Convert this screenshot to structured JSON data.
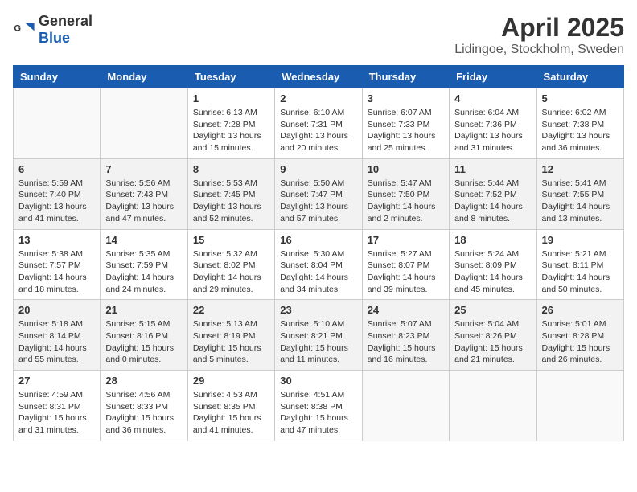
{
  "header": {
    "logo_general": "General",
    "logo_blue": "Blue",
    "month_year": "April 2025",
    "location": "Lidingoe, Stockholm, Sweden"
  },
  "days_of_week": [
    "Sunday",
    "Monday",
    "Tuesday",
    "Wednesday",
    "Thursday",
    "Friday",
    "Saturday"
  ],
  "weeks": [
    [
      {
        "day": "",
        "info": ""
      },
      {
        "day": "",
        "info": ""
      },
      {
        "day": "1",
        "info": "Sunrise: 6:13 AM\nSunset: 7:28 PM\nDaylight: 13 hours and 15 minutes."
      },
      {
        "day": "2",
        "info": "Sunrise: 6:10 AM\nSunset: 7:31 PM\nDaylight: 13 hours and 20 minutes."
      },
      {
        "day": "3",
        "info": "Sunrise: 6:07 AM\nSunset: 7:33 PM\nDaylight: 13 hours and 25 minutes."
      },
      {
        "day": "4",
        "info": "Sunrise: 6:04 AM\nSunset: 7:36 PM\nDaylight: 13 hours and 31 minutes."
      },
      {
        "day": "5",
        "info": "Sunrise: 6:02 AM\nSunset: 7:38 PM\nDaylight: 13 hours and 36 minutes."
      }
    ],
    [
      {
        "day": "6",
        "info": "Sunrise: 5:59 AM\nSunset: 7:40 PM\nDaylight: 13 hours and 41 minutes."
      },
      {
        "day": "7",
        "info": "Sunrise: 5:56 AM\nSunset: 7:43 PM\nDaylight: 13 hours and 47 minutes."
      },
      {
        "day": "8",
        "info": "Sunrise: 5:53 AM\nSunset: 7:45 PM\nDaylight: 13 hours and 52 minutes."
      },
      {
        "day": "9",
        "info": "Sunrise: 5:50 AM\nSunset: 7:47 PM\nDaylight: 13 hours and 57 minutes."
      },
      {
        "day": "10",
        "info": "Sunrise: 5:47 AM\nSunset: 7:50 PM\nDaylight: 14 hours and 2 minutes."
      },
      {
        "day": "11",
        "info": "Sunrise: 5:44 AM\nSunset: 7:52 PM\nDaylight: 14 hours and 8 minutes."
      },
      {
        "day": "12",
        "info": "Sunrise: 5:41 AM\nSunset: 7:55 PM\nDaylight: 14 hours and 13 minutes."
      }
    ],
    [
      {
        "day": "13",
        "info": "Sunrise: 5:38 AM\nSunset: 7:57 PM\nDaylight: 14 hours and 18 minutes."
      },
      {
        "day": "14",
        "info": "Sunrise: 5:35 AM\nSunset: 7:59 PM\nDaylight: 14 hours and 24 minutes."
      },
      {
        "day": "15",
        "info": "Sunrise: 5:32 AM\nSunset: 8:02 PM\nDaylight: 14 hours and 29 minutes."
      },
      {
        "day": "16",
        "info": "Sunrise: 5:30 AM\nSunset: 8:04 PM\nDaylight: 14 hours and 34 minutes."
      },
      {
        "day": "17",
        "info": "Sunrise: 5:27 AM\nSunset: 8:07 PM\nDaylight: 14 hours and 39 minutes."
      },
      {
        "day": "18",
        "info": "Sunrise: 5:24 AM\nSunset: 8:09 PM\nDaylight: 14 hours and 45 minutes."
      },
      {
        "day": "19",
        "info": "Sunrise: 5:21 AM\nSunset: 8:11 PM\nDaylight: 14 hours and 50 minutes."
      }
    ],
    [
      {
        "day": "20",
        "info": "Sunrise: 5:18 AM\nSunset: 8:14 PM\nDaylight: 14 hours and 55 minutes."
      },
      {
        "day": "21",
        "info": "Sunrise: 5:15 AM\nSunset: 8:16 PM\nDaylight: 15 hours and 0 minutes."
      },
      {
        "day": "22",
        "info": "Sunrise: 5:13 AM\nSunset: 8:19 PM\nDaylight: 15 hours and 5 minutes."
      },
      {
        "day": "23",
        "info": "Sunrise: 5:10 AM\nSunset: 8:21 PM\nDaylight: 15 hours and 11 minutes."
      },
      {
        "day": "24",
        "info": "Sunrise: 5:07 AM\nSunset: 8:23 PM\nDaylight: 15 hours and 16 minutes."
      },
      {
        "day": "25",
        "info": "Sunrise: 5:04 AM\nSunset: 8:26 PM\nDaylight: 15 hours and 21 minutes."
      },
      {
        "day": "26",
        "info": "Sunrise: 5:01 AM\nSunset: 8:28 PM\nDaylight: 15 hours and 26 minutes."
      }
    ],
    [
      {
        "day": "27",
        "info": "Sunrise: 4:59 AM\nSunset: 8:31 PM\nDaylight: 15 hours and 31 minutes."
      },
      {
        "day": "28",
        "info": "Sunrise: 4:56 AM\nSunset: 8:33 PM\nDaylight: 15 hours and 36 minutes."
      },
      {
        "day": "29",
        "info": "Sunrise: 4:53 AM\nSunset: 8:35 PM\nDaylight: 15 hours and 41 minutes."
      },
      {
        "day": "30",
        "info": "Sunrise: 4:51 AM\nSunset: 8:38 PM\nDaylight: 15 hours and 47 minutes."
      },
      {
        "day": "",
        "info": ""
      },
      {
        "day": "",
        "info": ""
      },
      {
        "day": "",
        "info": ""
      }
    ]
  ]
}
